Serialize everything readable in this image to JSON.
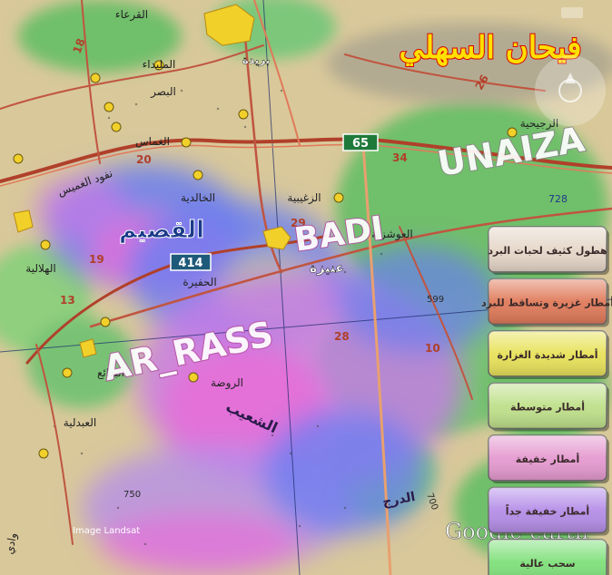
{
  "title": "فيحان السهلي",
  "watermark_text": "Google earth",
  "imagery_credit": "Image Landsat",
  "region_name": "القصيم",
  "overlay_labels": {
    "unaizah": "UNAIZA",
    "badi": "BADI",
    "ar_rass": "AR_RASS"
  },
  "road_shields": {
    "r65": "65",
    "r414": "414",
    "r728": "728"
  },
  "road_numbers": {
    "n18": "18",
    "n26": "26",
    "n34": "34",
    "n13": "13",
    "n28": "28",
    "n10": "10",
    "n20": "20",
    "n29": "29",
    "n19": "19",
    "n599": "599",
    "n750": "750",
    "n700": "700"
  },
  "towns": {
    "buraydah": "بريدة",
    "alqaraa": "القرعاء",
    "almulaidaa": "المليداء",
    "albasr": "البصر",
    "alghamas": "الغماس",
    "nafud": "نفود الغميس",
    "alkhalidiya": "الخالدية",
    "alhilaliya": "الهلالية",
    "alhufayra": "الحفيرة",
    "unayzah": "عنيزة",
    "azzughaibiya": "الزغيبية",
    "alawshaziya": "العوشزية",
    "albadaea": "البدائع",
    "arraudha": "الروضة",
    "alabdaliya": "العبدلية",
    "arrijayhiya": "الرجيحية",
    "wadi": "وادي",
    "shaib": "الشعيب",
    "drj": "الدرج"
  },
  "legend": {
    "items": [
      {
        "label": "هطول كثيف لحبات البرد",
        "color": "#e6d7c9"
      },
      {
        "label": "أمطار غزيرة وتساقط للبرد",
        "color": "#e07a5a"
      },
      {
        "label": "أمطار شديدة الغزارة",
        "color": "#e8e25a"
      },
      {
        "label": "أمطار متوسطة",
        "color": "#bfe08a"
      },
      {
        "label": "أمطار خفيفة",
        "color": "#e59ad0"
      },
      {
        "label": "أمطار خفيفة جداً",
        "color": "#b58ee8"
      },
      {
        "label": "سحب عالية",
        "color": "#7fe07a"
      }
    ]
  },
  "colors": {
    "title_fill": "#ffe000",
    "title_stroke": "#d80000",
    "map_base": "#d9c89a",
    "green_area": "#6fbf6a",
    "rain_blue": "#6a7ef0",
    "rain_purple": "#c77ae8",
    "rain_pink": "#e86fd8",
    "road_red": "#b0402a",
    "town_yellow": "#f2d02a"
  }
}
